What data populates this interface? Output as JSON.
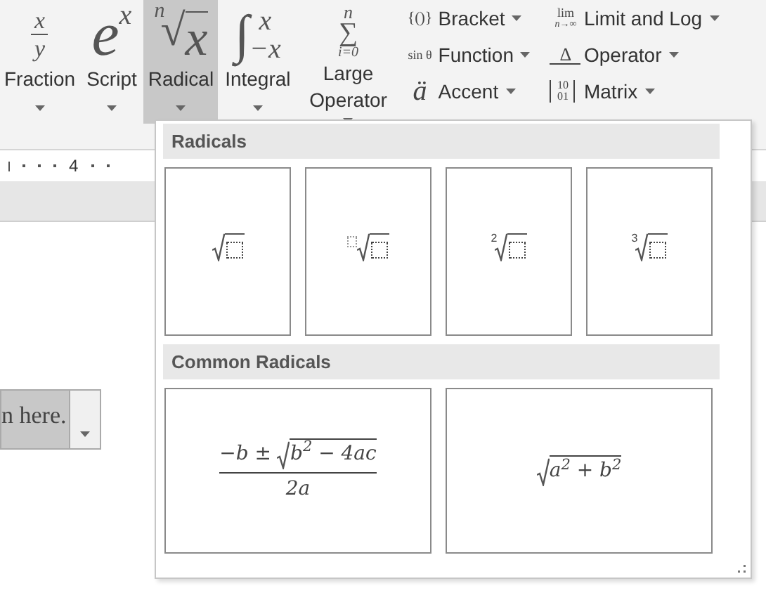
{
  "ribbon": {
    "large_buttons": [
      {
        "kind": "fraction",
        "num": "x",
        "den": "y",
        "label": "Fraction",
        "selected": false
      },
      {
        "kind": "script",
        "base": "e",
        "sup": "x",
        "label": "Script",
        "selected": false
      },
      {
        "kind": "radical",
        "sign": "√",
        "index": "n",
        "radicand": "x",
        "label": "Radical",
        "selected": true
      },
      {
        "kind": "integral",
        "sign": "∫",
        "upper": "x",
        "lower": "−x",
        "label": "Integral",
        "selected": false
      },
      {
        "kind": "sum",
        "sign": "∑",
        "upper": "n",
        "lower": "i=0",
        "label": "Large Operator",
        "selected": false
      }
    ],
    "small_buttons": [
      {
        "kind": "bracket",
        "symbol": "{()}",
        "label": "Bracket"
      },
      {
        "kind": "function",
        "symbol": "sin θ",
        "label": "Function"
      },
      {
        "kind": "accent",
        "symbol": "ä",
        "label": "Accent"
      },
      {
        "kind": "limit",
        "symbol": "lim",
        "sub": "n→∞",
        "label": "Limit and Log"
      },
      {
        "kind": "operator",
        "symbol": "Δ",
        "label": "Operator"
      },
      {
        "kind": "matrix",
        "rows": [
          "10",
          "01"
        ],
        "label": "Matrix"
      }
    ]
  },
  "ruler": {
    "marker": "4"
  },
  "document": {
    "content_control": "n here."
  },
  "gallery": {
    "sections": [
      {
        "title": "Radicals",
        "items": [
          {
            "kind": "square_root"
          },
          {
            "kind": "placeholder_index"
          },
          {
            "kind": "numbered_index",
            "index": "2"
          },
          {
            "kind": "numbered_index",
            "index": "3"
          }
        ]
      },
      {
        "title": "Common Radicals",
        "items": [
          {
            "kind": "quadratic",
            "prefix": "−b ± ",
            "radicand": "b$^{2}$ − 4ac",
            "denominator": "2a"
          },
          {
            "kind": "root",
            "radicand": "a$^{2}$ + b$^{2}$"
          }
        ]
      }
    ]
  }
}
